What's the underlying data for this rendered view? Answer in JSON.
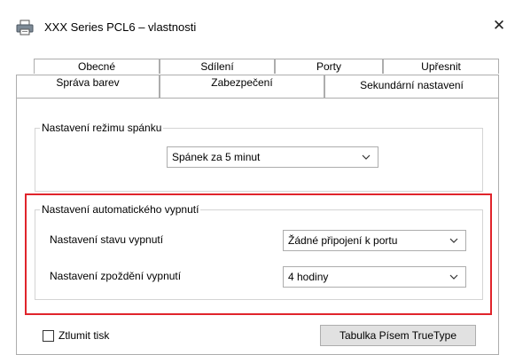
{
  "window": {
    "title": "XXX Series PCL6 – vlastnosti",
    "close_glyph": "✕"
  },
  "tabs": {
    "row1": [
      "Obecné",
      "Sdílení",
      "Porty",
      "Upřesnit"
    ],
    "row2": [
      "Správa barev",
      "Zabezpečení",
      "Sekundární nastavení"
    ],
    "active": "Sekundární nastavení"
  },
  "sleep": {
    "legend": "Nastavení režimu spánku",
    "value": "Spánek za 5 minut"
  },
  "auto_off": {
    "legend": "Nastavení automatického vypnutí",
    "state_label": "Nastavení stavu vypnutí",
    "state_value": "Žádné připojení k portu",
    "delay_label": "Nastavení zpoždění vypnutí",
    "delay_value": "4 hodiny"
  },
  "footer": {
    "mute_label": "Ztlumit tisk",
    "mute_checked": false,
    "truetype_button": "Tabulka Písem TrueType"
  },
  "colors": {
    "highlight": "#e0242b",
    "border": "#adadad"
  },
  "icons": [
    "printer-icon",
    "close-icon",
    "chevron-down-icon",
    "checkbox-icon"
  ]
}
